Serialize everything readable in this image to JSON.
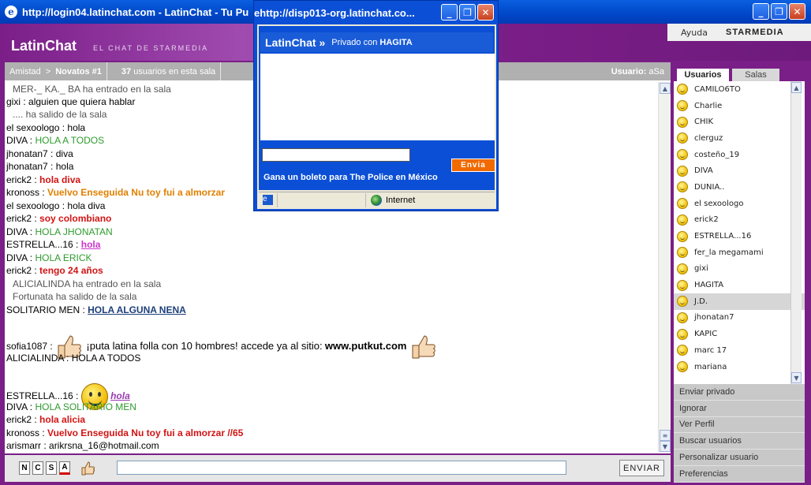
{
  "browser": {
    "title": "http://login04.latinchat.com - LatinChat - Tu Pu"
  },
  "header": {
    "logo": "LatinChat",
    "tagline": "EL CHAT DE STARMEDIA",
    "help": "Ayuda",
    "brand": "STARMEDIA"
  },
  "breadcrumb": {
    "root": "Amistad",
    "sep": ">",
    "room": "Novatos #1",
    "count": "37",
    "count_label": "usuarios en esta sala",
    "user_label": "Usuario:",
    "user": "aSa"
  },
  "messages": [
    {
      "type": "sys",
      "text": "MER-_ KA._ BA ha entrado en la sala"
    },
    {
      "type": "msg",
      "nick": "gixi",
      "text": "alguien que quiera hablar",
      "style": "plain"
    },
    {
      "type": "sys",
      "text": ".... ha salido de la sala"
    },
    {
      "type": "msg",
      "nick": "el sexoologo",
      "text": "hola",
      "style": "plain"
    },
    {
      "type": "msg",
      "nick": "DIVA",
      "text": "HOLA A TODOS",
      "style": "g"
    },
    {
      "type": "msg",
      "nick": "jhonatan7",
      "text": "diva",
      "style": "plain"
    },
    {
      "type": "msg",
      "nick": "jhonatan7",
      "text": "hola",
      "style": "plain"
    },
    {
      "type": "msg",
      "nick": "erick2",
      "text": "hola diva",
      "style": "r"
    },
    {
      "type": "msg",
      "nick": "kronoss",
      "text": "Vuelvo Enseguida Nu toy fui a almorzar",
      "style": "o"
    },
    {
      "type": "msg",
      "nick": "el sexoologo",
      "text": "hola diva",
      "style": "plain"
    },
    {
      "type": "msg",
      "nick": "erick2",
      "text": "soy colombiano",
      "style": "r"
    },
    {
      "type": "msg",
      "nick": "DIVA",
      "text": "HOLA JHONATAN",
      "style": "g"
    },
    {
      "type": "msg",
      "nick": "ESTRELLA...16",
      "text": "hola",
      "style": "p"
    },
    {
      "type": "msg",
      "nick": "DIVA",
      "text": "HOLA ERICK",
      "style": "g"
    },
    {
      "type": "msg",
      "nick": "erick2",
      "text": "tengo 24 años",
      "style": "r"
    },
    {
      "type": "sys",
      "text": "ALICIALINDA ha entrado en la sala"
    },
    {
      "type": "sys",
      "text": "Fortunata ha salido de la sala"
    },
    {
      "type": "msg",
      "nick": "SOLITARIO MEN",
      "text": "HOLA ALGUNA NENA",
      "style": "b"
    },
    {
      "type": "ad",
      "nick": "sofia1087",
      "text": "¡puta latina folla con 10 hombres! accede ya al sitio:",
      "site": "www.putkut.com"
    },
    {
      "type": "msg",
      "nick": "ALICIALINDA",
      "text": "HOLA A TODOS",
      "style": "plain"
    },
    {
      "type": "smiley",
      "nick": "ESTRELLA...16",
      "text": "hola"
    },
    {
      "type": "msg",
      "nick": "DIVA",
      "text": "HOLA SOLITARIO MEN",
      "style": "g"
    },
    {
      "type": "msg",
      "nick": "erick2",
      "text": "hola alicia",
      "style": "r"
    },
    {
      "type": "msg",
      "nick": "kronoss",
      "text": "Vuelvo Enseguida Nu toy fui a almorzar //65",
      "style": "r"
    },
    {
      "type": "msg",
      "nick": "arismarr",
      "text": "arikrsna_16@hotmail.com",
      "style": "plain"
    }
  ],
  "sidebar": {
    "tab_users": "Usuarios",
    "tab_rooms": "Salas",
    "users": [
      "CAMILO6TO",
      "Charlie",
      "CHIK",
      "clerguz",
      "costeño_19",
      "DIVA",
      "DUNIA..",
      "el sexoologo",
      "erick2",
      "ESTRELLA...16",
      "fer_la megamami",
      "gixi",
      "HAGITA",
      "J.D.",
      "jhonatan7",
      "KAPIC",
      "marc 17",
      "mariana"
    ],
    "selected_user": "J.D.",
    "actions": [
      "Enviar privado",
      "Ignorar",
      "Ver Perfil",
      "Buscar usuarios",
      "Personalizar usuario",
      "Preferencias"
    ]
  },
  "input": {
    "format_buttons": [
      "N",
      "C",
      "S",
      "A"
    ],
    "send": "ENVIAR",
    "value": ""
  },
  "popup": {
    "title": "http://disp013-org.latinchat.co...",
    "logo": "LatinChat »",
    "private_label": "Privado con",
    "private_user": "HAGITA",
    "send": "Envia",
    "promo": "Gana un boleto para The Police en México",
    "status": "Internet"
  },
  "colors": {
    "purple": "#7a1f87",
    "titlebar": "#0047c8",
    "green_text": "#2e9b2e",
    "red_text": "#d21414",
    "orange_button": "#f06a00"
  }
}
